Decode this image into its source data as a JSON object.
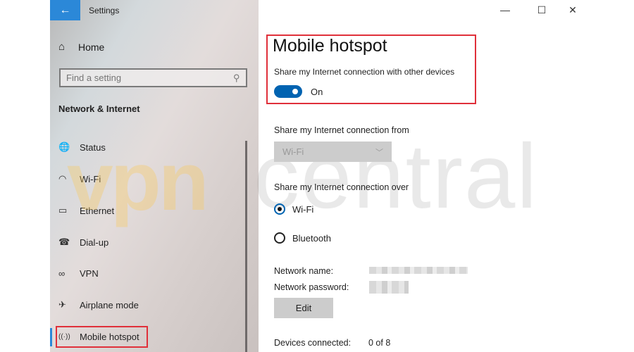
{
  "window": {
    "title": "Settings",
    "back_icon": "←",
    "controls": {
      "minimize": "—",
      "maximize": "☐",
      "close": "✕"
    }
  },
  "sidebar": {
    "home_icon": "⌂",
    "home_label": "Home",
    "search_placeholder": "Find a setting",
    "search_icon": "⚲",
    "section_heading": "Network & Internet",
    "items": [
      {
        "label": "Status",
        "icon": "🌐"
      },
      {
        "label": "Wi-Fi",
        "icon": "◠"
      },
      {
        "label": "Ethernet",
        "icon": "▭"
      },
      {
        "label": "Dial-up",
        "icon": "☎"
      },
      {
        "label": "VPN",
        "icon": "∞"
      },
      {
        "label": "Airplane mode",
        "icon": "✈"
      },
      {
        "label": "Mobile hotspot",
        "icon": "((·))"
      }
    ],
    "active_item": "Mobile hotspot"
  },
  "main": {
    "title": "Mobile hotspot",
    "share_label": "Share my Internet connection with other devices",
    "toggle_state": "On",
    "share_from_label": "Share my Internet connection from",
    "share_from_value": "Wi-Fi",
    "share_over_label": "Share my Internet connection over",
    "share_over_options": [
      {
        "label": "Wi-Fi",
        "selected": true
      },
      {
        "label": "Bluetooth",
        "selected": false
      }
    ],
    "network_name_label": "Network name:",
    "network_password_label": "Network password:",
    "edit_label": "Edit",
    "devices_label": "Devices connected:",
    "devices_value": "0 of 8"
  },
  "watermark": {
    "left": "vpn",
    "right": "central"
  },
  "colors": {
    "accent": "#0063b1",
    "back_button": "#2b88d8",
    "highlight": "#e0303a"
  }
}
